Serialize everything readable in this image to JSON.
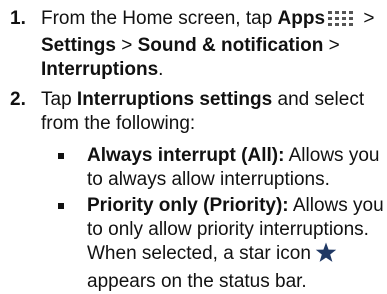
{
  "steps": [
    {
      "number": "1.",
      "from_text": "From the Home screen, tap ",
      "apps_label": "Apps",
      "sep1": " > ",
      "settings_label": "Settings",
      "sep2": " > ",
      "sound_label": "Sound & notification",
      "sep3": " > ",
      "interruptions_label": "Interruptions",
      "end": "."
    },
    {
      "number": "2.",
      "tap_text": "Tap ",
      "settings_label": "Interruptions settings",
      "after_text": " and select from the following:"
    }
  ],
  "options": [
    {
      "title": "Always interrupt (All):",
      "desc": " Allows you to always allow interruptions."
    },
    {
      "title": "Priority only (Priority):",
      "desc": " Allows you to only allow priority interruptions. When selected, a star icon",
      "desc_end": "appears on the status bar."
    }
  ],
  "icons": {
    "apps": "apps-grid-icon",
    "star": "star-icon"
  },
  "colors": {
    "text": "#111111",
    "apps_icon": "#555555",
    "star_icon": "#1f3864"
  }
}
